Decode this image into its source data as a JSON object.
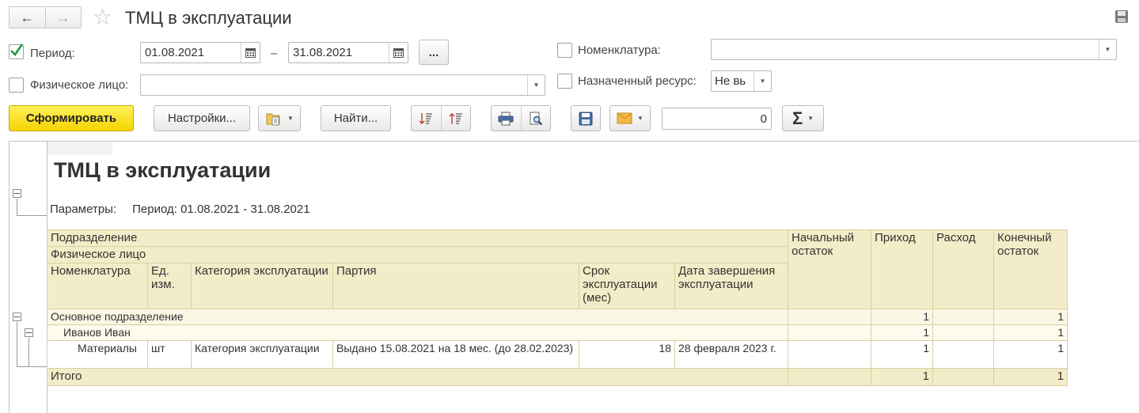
{
  "header": {
    "title": "ТМЦ в эксплуатации",
    "back_arrow": "←",
    "forward_arrow": "→",
    "favorite_glyph": "☆"
  },
  "filters": {
    "period": {
      "label": "Период:",
      "checked": true,
      "date_from": "01.08.2021",
      "dash": "–",
      "date_to": "31.08.2021",
      "more_label": "..."
    },
    "person": {
      "label": "Физическое лицо:",
      "checked": false,
      "value": ""
    },
    "nomenclature": {
      "label": "Номенклатура:",
      "checked": false,
      "value": ""
    },
    "resource": {
      "label": "Назначенный ресурс:",
      "checked": false,
      "value": "Не вь"
    }
  },
  "toolbar": {
    "generate_label": "Сформировать",
    "settings_label": "Настройки...",
    "find_label": "Найти...",
    "counter_value": "0",
    "sum_glyph": "Σ"
  },
  "report": {
    "title": "ТМЦ в эксплуатации",
    "params_label": "Параметры:",
    "params_value": "Период: 01.08.2021 - 31.08.2021",
    "headers": {
      "division": "Подразделение",
      "person": "Физическое лицо",
      "nomenclature": "Номенклатура",
      "unit": "Ед. изм.",
      "category": "Категория эксплуатации",
      "batch": "Партия",
      "term": "Срок эксплуатации (мес)",
      "end_date": "Дата завершения эксплуатации",
      "opening": "Начальный остаток",
      "income": "Приход",
      "expense": "Расход",
      "closing": "Конечный остаток"
    },
    "rows": {
      "division": {
        "name": "Основное подразделение",
        "opening": "",
        "income": "1",
        "expense": "",
        "closing": "1"
      },
      "person": {
        "name": "Иванов Иван",
        "opening": "",
        "income": "1",
        "expense": "",
        "closing": "1"
      },
      "detail": {
        "nomenclature": "Материалы",
        "unit": "шт",
        "category": "Категория эксплуатации",
        "batch": "Выдано 15.08.2021 на 18 мес. (до 28.02.2023)",
        "term": "18",
        "end_date": "28 февраля 2023 г.",
        "opening": "",
        "income": "1",
        "expense": "",
        "closing": "1"
      }
    },
    "total": {
      "label": "Итого",
      "opening": "",
      "income": "1",
      "expense": "",
      "closing": "1"
    }
  }
}
